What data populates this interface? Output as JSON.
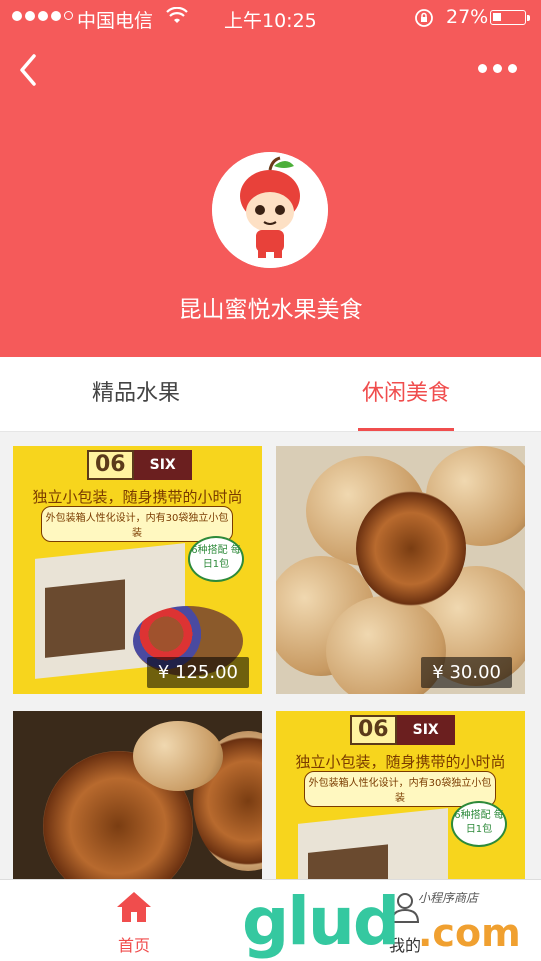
{
  "status_bar": {
    "carrier": "中国电信",
    "time": "上午10:25",
    "battery_percent": "27%",
    "signal_bars_filled": 4,
    "signal_bars_total": 5,
    "battery_level": 0.27
  },
  "nav": {
    "back_icon": "chevron-left-icon",
    "more_icon": "more-dots-icon"
  },
  "shop": {
    "name": "昆山蜜悦水果美食",
    "avatar_icon": "apple-mascot-avatar"
  },
  "tabs": [
    {
      "label": "精品水果",
      "active": false
    },
    {
      "label": "休闲美食",
      "active": true
    }
  ],
  "products": [
    {
      "price": "¥ 125.00",
      "promo": {
        "number": "06",
        "tag": "SIX",
        "line1": "独立小包装，随身携带的小时尚",
        "line2": "外包装箱人性化设计，内有30袋独立小包装",
        "seal": "6种搭配 每日1包"
      }
    },
    {
      "price": "¥ 30.00"
    },
    {
      "price": ""
    },
    {
      "price": "",
      "promo": {
        "number": "06",
        "tag": "SIX",
        "line1": "独立小包装，随身携带的小时尚",
        "line2": "外包装箱人性化设计，内有30袋独立小包装",
        "seal": "6种搭配 每日1包"
      }
    }
  ],
  "bottom_nav": [
    {
      "label": "首页",
      "icon": "home-icon",
      "active": true
    },
    {
      "label": "我的",
      "icon": "user-icon",
      "active": false
    }
  ],
  "watermark": {
    "brand": "glud",
    "suffix": ".com",
    "small": "小程序商店"
  },
  "colors": {
    "brand_red": "#f55a5a",
    "active_tab": "#f04d4d",
    "promo_yellow": "#f7d51d"
  }
}
